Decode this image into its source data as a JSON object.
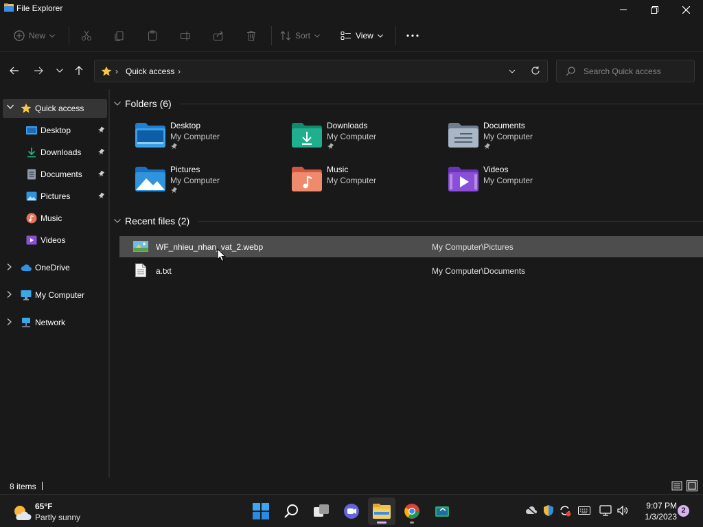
{
  "window": {
    "title": "File Explorer"
  },
  "toolbar": {
    "new_label": "New",
    "sort_label": "Sort",
    "view_label": "View"
  },
  "address": {
    "location": "Quick access",
    "search_placeholder": "Search Quick access"
  },
  "sidebar": {
    "items": [
      {
        "label": "Quick access",
        "icon": "star-icon"
      },
      {
        "label": "Desktop",
        "icon": "desktop-icon"
      },
      {
        "label": "Downloads",
        "icon": "download-icon"
      },
      {
        "label": "Documents",
        "icon": "document-icon"
      },
      {
        "label": "Pictures",
        "icon": "pictures-icon"
      },
      {
        "label": "Music",
        "icon": "music-icon"
      },
      {
        "label": "Videos",
        "icon": "videos-icon"
      },
      {
        "label": "OneDrive",
        "icon": "cloud-icon"
      },
      {
        "label": "My Computer",
        "icon": "monitor-icon"
      },
      {
        "label": "Network",
        "icon": "network-icon"
      }
    ]
  },
  "content": {
    "folders_header": "Folders (6)",
    "recent_header": "Recent files (2)",
    "folders": [
      {
        "name": "Desktop",
        "location": "My Computer",
        "pinned": true,
        "color": "#3aa0e8"
      },
      {
        "name": "Downloads",
        "location": "My Computer",
        "pinned": true,
        "color": "#1fae8e"
      },
      {
        "name": "Documents",
        "location": "My Computer",
        "pinned": true,
        "color": "#8d9aab"
      },
      {
        "name": "Pictures",
        "location": "My Computer",
        "pinned": true,
        "color": "#2f93de"
      },
      {
        "name": "Music",
        "location": "My Computer",
        "pinned": false,
        "color": "#e8735a"
      },
      {
        "name": "Videos",
        "location": "My Computer",
        "pinned": false,
        "color": "#8a4fd8"
      }
    ],
    "recent": [
      {
        "name": "WF_nhieu_nhan_vat_2.webp",
        "location": "My Computer\\Pictures",
        "icon": "image-file-icon"
      },
      {
        "name": "a.txt",
        "location": "My Computer\\Documents",
        "icon": "text-file-icon"
      }
    ]
  },
  "status": {
    "item_count": "8 items"
  },
  "taskbar": {
    "weather_temp": "65°F",
    "weather_cond": "Partly sunny",
    "time": "9:07 PM",
    "date": "1/3/2023",
    "notification_count": "2"
  },
  "colors": {
    "accent_yellow": "#f7c948",
    "background": "#191919",
    "selection": "#4d4d4d"
  }
}
